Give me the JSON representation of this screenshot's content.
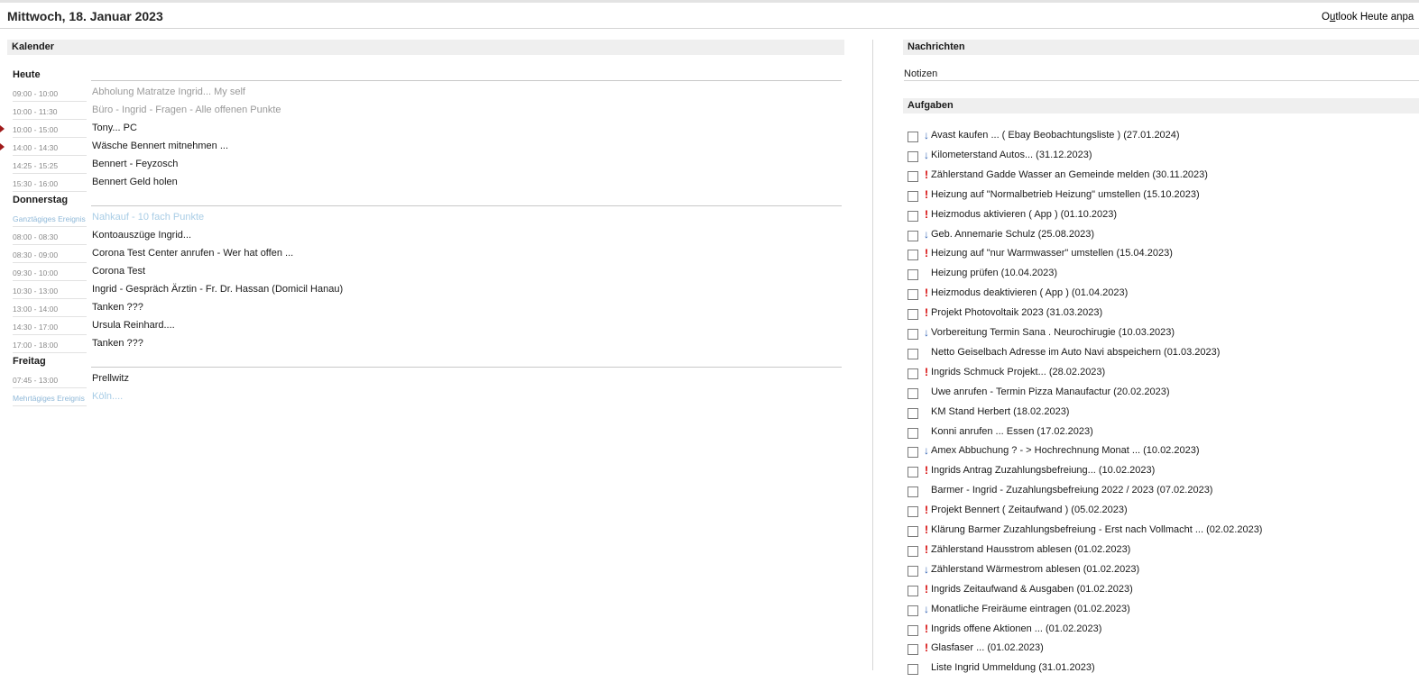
{
  "header": {
    "date": "Mittwoch, 18. Januar 2023",
    "customize_prefix": "O",
    "customize_ul": "u",
    "customize_rest": "tlook Heute anpa"
  },
  "calendar": {
    "title": "Kalender",
    "days": [
      {
        "label": "Heute",
        "events": [
          {
            "time": "09:00 - 10:00",
            "subject": "Abholung Matratze Ingrid... My self",
            "state": "past"
          },
          {
            "time": "10:00 - 11:30",
            "subject": "Büro - Ingrid - Fragen - Alle offenen Punkte",
            "state": "past"
          },
          {
            "time": "10:00 - 15:00",
            "subject": "Tony... PC",
            "state": "current"
          },
          {
            "time": "14:00 - 14:30",
            "subject": "Wäsche Bennert mitnehmen ...",
            "state": "current"
          },
          {
            "time": "14:25 - 15:25",
            "subject": "Bennert - Feyzosch",
            "state": "normal"
          },
          {
            "time": "15:30 - 16:00",
            "subject": "Bennert Geld holen",
            "state": "normal"
          }
        ]
      },
      {
        "label": "Donnerstag",
        "events": [
          {
            "time": "Ganztägiges Ereignis",
            "subject": "Nahkauf - 10 fach Punkte",
            "state": "allday"
          },
          {
            "time": "08:00 - 08:30",
            "subject": "Kontoauszüge Ingrid...",
            "state": "normal"
          },
          {
            "time": "08:30 - 09:00",
            "subject": "Corona Test Center anrufen - Wer hat offen ...",
            "state": "normal"
          },
          {
            "time": "09:30 - 10:00",
            "subject": "Corona Test",
            "state": "normal"
          },
          {
            "time": "10:30 - 13:00",
            "subject": "Ingrid - Gespräch Ärztin - Fr. Dr. Hassan (Domicil Hanau)",
            "state": "normal"
          },
          {
            "time": "13:00 - 14:00",
            "subject": "Tanken ???",
            "state": "normal"
          },
          {
            "time": "14:30 - 17:00",
            "subject": "Ursula Reinhard....",
            "state": "normal"
          },
          {
            "time": "17:00 - 18:00",
            "subject": "Tanken ???",
            "state": "normal"
          }
        ]
      },
      {
        "label": "Freitag",
        "events": [
          {
            "time": "07:45 - 13:00",
            "subject": "Prellwitz",
            "state": "normal"
          },
          {
            "time": "Mehrtägiges Ereignis",
            "subject": "Köln....",
            "state": "allday"
          }
        ]
      }
    ]
  },
  "messages": {
    "title": "Nachrichten",
    "notes_label": "Notizen"
  },
  "tasks": {
    "title": "Aufgaben",
    "priority_glyphs": {
      "high": "!",
      "low": "↓",
      "normal": ""
    },
    "priority_colors": {
      "high": "#d40000",
      "low": "#2a5db0"
    },
    "items": [
      {
        "priority": "low",
        "text": "Avast kaufen ... ( Ebay Beobachtungsliste ) (27.01.2024)"
      },
      {
        "priority": "low",
        "text": "Kilometerstand Autos... (31.12.2023)"
      },
      {
        "priority": "high",
        "text": "Zählerstand Gadde Wasser an Gemeinde melden (30.11.2023)"
      },
      {
        "priority": "high",
        "text": "Heizung auf \"Normalbetrieb Heizung\" umstellen (15.10.2023)"
      },
      {
        "priority": "high",
        "text": "Heizmodus aktivieren ( App ) (01.10.2023)"
      },
      {
        "priority": "low",
        "text": "Geb. Annemarie Schulz (25.08.2023)"
      },
      {
        "priority": "high",
        "text": "Heizung auf \"nur Warmwasser\" umstellen (15.04.2023)"
      },
      {
        "priority": "normal",
        "text": "Heizung prüfen (10.04.2023)"
      },
      {
        "priority": "high",
        "text": "Heizmodus deaktivieren ( App ) (01.04.2023)"
      },
      {
        "priority": "high",
        "text": "Projekt Photovoltaik 2023 (31.03.2023)"
      },
      {
        "priority": "low",
        "text": "Vorbereitung Termin Sana . Neurochirugie (10.03.2023)"
      },
      {
        "priority": "normal",
        "text": "Netto Geiselbach Adresse im Auto Navi abspeichern (01.03.2023)"
      },
      {
        "priority": "high",
        "text": "Ingrids Schmuck Projekt... (28.02.2023)"
      },
      {
        "priority": "normal",
        "text": "Uwe anrufen - Termin Pizza Manaufactur (20.02.2023)"
      },
      {
        "priority": "normal",
        "text": "KM Stand Herbert (18.02.2023)"
      },
      {
        "priority": "normal",
        "text": "Konni anrufen ... Essen (17.02.2023)"
      },
      {
        "priority": "low",
        "text": "Amex Abbuchung ? - > Hochrechnung Monat ... (10.02.2023)"
      },
      {
        "priority": "high",
        "text": "Ingrids Antrag Zuzahlungsbefreiung... (10.02.2023)"
      },
      {
        "priority": "normal",
        "text": "Barmer - Ingrid - Zuzahlungsbefreiung 2022 / 2023 (07.02.2023)"
      },
      {
        "priority": "high",
        "text": "Projekt Bennert ( Zeitaufwand ) (05.02.2023)"
      },
      {
        "priority": "high",
        "text": "Klärung Barmer Zuzahlungsbefreiung - Erst nach Vollmacht ... (02.02.2023)"
      },
      {
        "priority": "high",
        "text": "Zählerstand Hausstrom ablesen (01.02.2023)"
      },
      {
        "priority": "low",
        "text": "Zählerstand Wärmestrom ablesen (01.02.2023)"
      },
      {
        "priority": "high",
        "text": "Ingrids Zeitaufwand & Ausgaben (01.02.2023)"
      },
      {
        "priority": "low",
        "text": "Monatliche Freiräume eintragen (01.02.2023)"
      },
      {
        "priority": "high",
        "text": "Ingrids offene Aktionen ... (01.02.2023)"
      },
      {
        "priority": "high",
        "text": "Glasfaser ... (01.02.2023)"
      },
      {
        "priority": "normal",
        "text": "Liste Ingrid Ummeldung (31.01.2023)"
      }
    ]
  }
}
